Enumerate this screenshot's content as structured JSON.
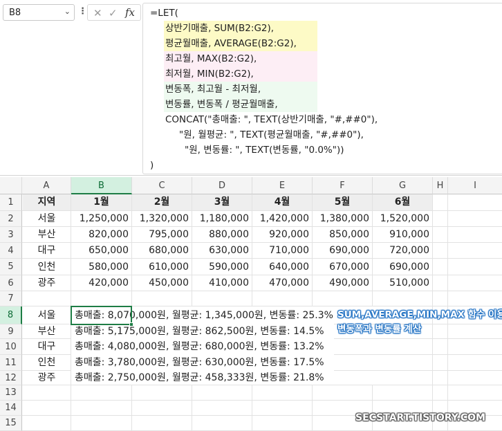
{
  "formula_bar": {
    "name_box": "B8",
    "name_box_caret": "⌄",
    "more_menu": "⋮",
    "cancel_glyph": "✕",
    "enter_glyph": "✓",
    "fx_glyph": "fx",
    "lines": [
      "=LET(",
      "상반기매출, SUM(B2:G2),",
      "평균월매출, AVERAGE(B2:G2),",
      "최고월, MAX(B2:G2),",
      "최저월, MIN(B2:G2),",
      "변동폭, 최고월 - 최저월,",
      "변동률, 변동폭 / 평균월매출,",
      "CONCAT(\"총매출: \", TEXT(상반기매출, \"#,##0\"),",
      "\"원, 월평균: \", TEXT(평균월매출, \"#,##0\"),",
      "\"원, 변동률: \", TEXT(변동률, \"0.0%\"))",
      ")"
    ],
    "highlight_colors": {
      "yellow": "#fdfac6",
      "pink": "#fdeef5",
      "green": "#eefaf0"
    }
  },
  "grid": {
    "columns": [
      "A",
      "B",
      "C",
      "D",
      "E",
      "F",
      "G",
      "H",
      "I"
    ],
    "rows": [
      "1",
      "2",
      "3",
      "4",
      "5",
      "6",
      "7",
      "8",
      "9",
      "10",
      "11",
      "12",
      "13",
      "14",
      "15"
    ],
    "selected_cell": "B8",
    "selection_color": "#1e7d45"
  },
  "table": {
    "headers": [
      "지역",
      "1월",
      "2월",
      "3월",
      "4월",
      "5월",
      "6월"
    ],
    "rows": [
      {
        "region": "서울",
        "values": [
          "1,250,000",
          "1,320,000",
          "1,180,000",
          "1,420,000",
          "1,380,000",
          "1,520,000"
        ]
      },
      {
        "region": "부산",
        "values": [
          "820,000",
          "795,000",
          "880,000",
          "920,000",
          "850,000",
          "910,000"
        ]
      },
      {
        "region": "대구",
        "values": [
          "650,000",
          "680,000",
          "630,000",
          "710,000",
          "690,000",
          "720,000"
        ]
      },
      {
        "region": "인천",
        "values": [
          "580,000",
          "610,000",
          "590,000",
          "640,000",
          "670,000",
          "690,000"
        ]
      },
      {
        "region": "광주",
        "values": [
          "420,000",
          "450,000",
          "410,000",
          "470,000",
          "490,000",
          "510,000"
        ]
      }
    ]
  },
  "results": [
    {
      "region": "서울",
      "text": "총매출: 8,070,000원, 월평균: 1,345,000원, 변동률: 25.3%"
    },
    {
      "region": "부산",
      "text": "총매출: 5,175,000원, 월평균: 862,500원, 변동률: 14.5%"
    },
    {
      "region": "대구",
      "text": "총매출: 4,080,000원, 월평균: 680,000원, 변동률: 13.2%"
    },
    {
      "region": "인천",
      "text": "총매출: 3,780,000원, 월평균: 630,000원, 변동률: 17.5%"
    },
    {
      "region": "광주",
      "text": "총매출: 2,750,000원, 월평균: 458,333원, 변동률: 21.8%"
    }
  ],
  "annotation": {
    "line1": "SUM,AVERAGE,MIN,MAX 함수 이용",
    "line2": "변동폭과 변동률 계산"
  },
  "watermark": "SECSTART.TISTORY.COM"
}
